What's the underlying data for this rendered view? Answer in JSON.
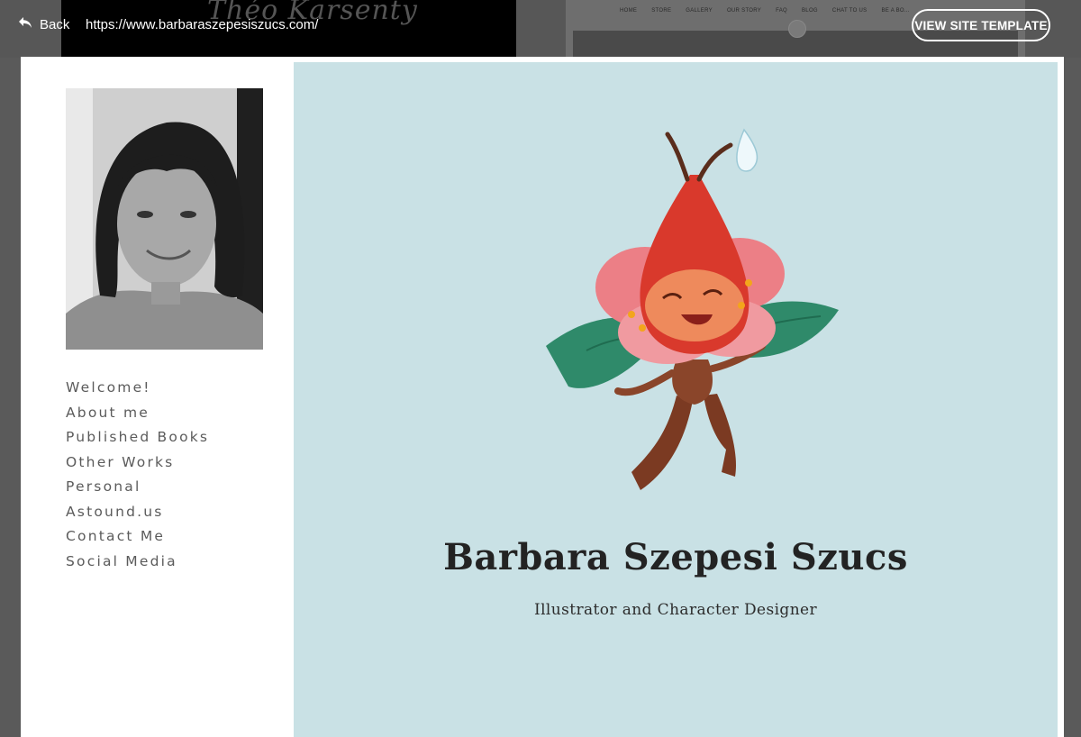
{
  "toolbar": {
    "back_label": "Back",
    "url": "https://www.barbaraszepesiszucs.com/",
    "view_template_label": "VIEW SITE TEMPLATE"
  },
  "background_preview": {
    "logo_text": "Théo Karsenty",
    "nav_items": [
      "HOME",
      "STORE",
      "GALLERY",
      "OUR STORY",
      "FAQ",
      "BLOG",
      "CHAT TO US",
      "BE A BO..."
    ]
  },
  "sidebar": {
    "nav_items": [
      {
        "label": "Welcome!"
      },
      {
        "label": "About me"
      },
      {
        "label": "Published Books"
      },
      {
        "label": "Other Works"
      },
      {
        "label": "Personal"
      },
      {
        "label": "Astound.us"
      },
      {
        "label": "Contact Me"
      },
      {
        "label": "Social Media"
      }
    ]
  },
  "hero": {
    "title": "Barbara Szepesi Szucs",
    "subtitle": "Illustrator and Character Designer",
    "background_color": "#c9e1e5"
  }
}
